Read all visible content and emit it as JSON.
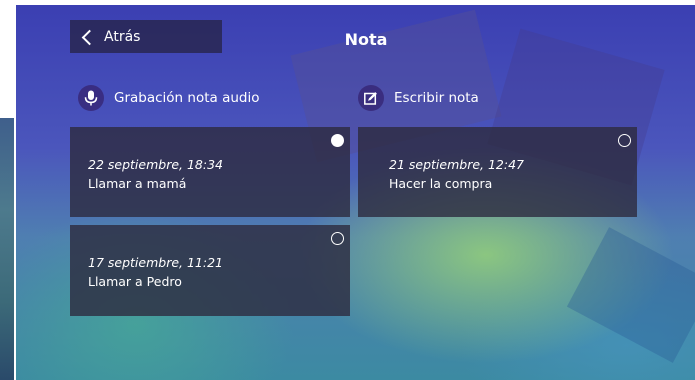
{
  "header": {
    "back_label": "Atrás",
    "title": "Nota"
  },
  "actions": {
    "audio": {
      "label": "Grabación nota audio",
      "icon": "microphone-icon"
    },
    "write": {
      "label": "Escribir nota",
      "icon": "edit-note-icon"
    }
  },
  "notes": [
    {
      "date": "22 septiembre, 18:34",
      "text": "Llamar a mamá",
      "selected": true
    },
    {
      "date": "21 septiembre, 12:47",
      "text": "Hacer la compra",
      "selected": false
    },
    {
      "date": "17 septiembre, 11:21",
      "text": "Llamar a Pedro",
      "selected": false
    }
  ],
  "colors": {
    "background_top": "#3b3fb2",
    "background_bottom": "#3c8aa2",
    "card": "#2d2a3e",
    "text": "#ffffff"
  }
}
